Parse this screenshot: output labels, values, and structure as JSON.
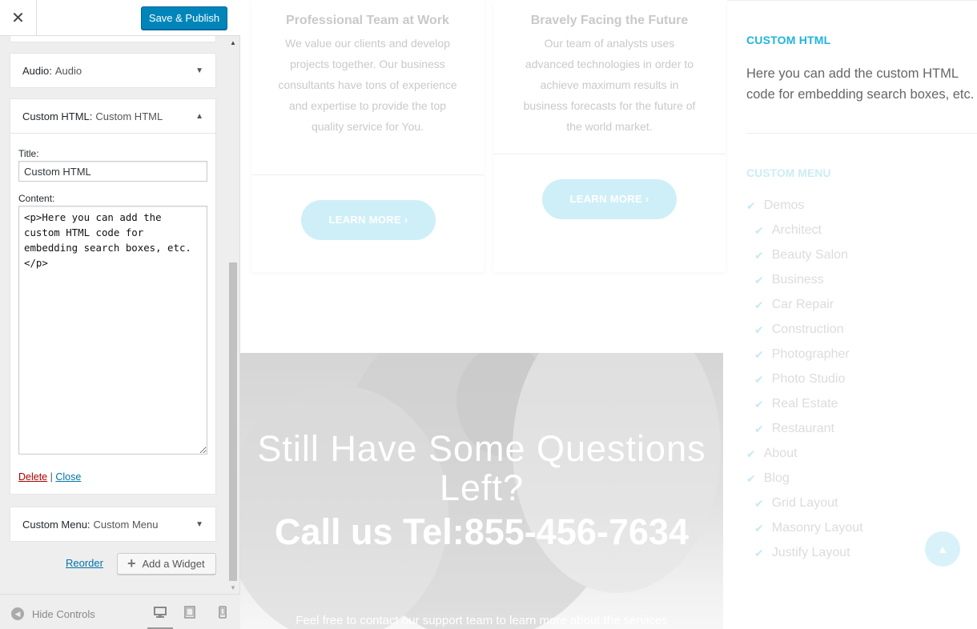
{
  "header": {
    "close_glyph": "✕",
    "save_label": "Save & Publish"
  },
  "widgets": {
    "audio": {
      "type": "Audio:",
      "name": "Audio"
    },
    "custom_html": {
      "type": "Custom HTML:",
      "name": "Custom HTML",
      "title_label": "Title:",
      "title_value": "Custom HTML",
      "content_label": "Content:",
      "content_value": "<p>Here you can add the custom HTML code for embedding search boxes, etc.</p>",
      "delete_label": "Delete",
      "separator": "|",
      "close_label": "Close"
    },
    "custom_menu": {
      "type": "Custom Menu:",
      "name": "Custom Menu"
    }
  },
  "actions": {
    "reorder_label": "Reorder",
    "add_widget_label": "Add a Widget"
  },
  "footer": {
    "hide_controls_label": "Hide Controls"
  },
  "preview": {
    "cards": [
      {
        "title": "Professional Team at Work",
        "text": "We value our clients and develop projects together. Our business consultants have tons of experience and expertise to provide the top quality service for You.",
        "button": "LEARN MORE ›"
      },
      {
        "title": "Bravely Facing the Future",
        "text": "Our team of analysts uses advanced technologies in order to achieve maximum results in business forecasts for the future of the world market.",
        "button": "LEARN MORE ›"
      }
    ],
    "cta": {
      "heading": "Still Have Some Questions Left?",
      "phone": "Call us Tel:855-456-7634",
      "subtext": "Feel free to contact our support team to learn more about the services"
    },
    "sidebar": {
      "html_title": "CUSTOM HTML",
      "html_text": "Here you can add the custom HTML code for embedding search boxes, etc.",
      "menu_title": "CUSTOM MENU",
      "menu_items": [
        {
          "label": "Demos",
          "level": 0
        },
        {
          "label": "Architect",
          "level": 1
        },
        {
          "label": "Beauty Salon",
          "level": 1
        },
        {
          "label": "Business",
          "level": 1
        },
        {
          "label": "Car Repair",
          "level": 1
        },
        {
          "label": "Construction",
          "level": 1
        },
        {
          "label": "Photographer",
          "level": 1
        },
        {
          "label": "Photo Studio",
          "level": 1
        },
        {
          "label": "Real Estate",
          "level": 1
        },
        {
          "label": "Restaurant",
          "level": 1
        },
        {
          "label": "About",
          "level": 0
        },
        {
          "label": "Blog",
          "level": 0
        },
        {
          "label": "Grid Layout",
          "level": 1
        },
        {
          "label": "Masonry Layout",
          "level": 1
        },
        {
          "label": "Justify Layout",
          "level": 1
        }
      ]
    }
  },
  "colors": {
    "primary_button": "#0085ba",
    "accent": "#1fb4dd",
    "delete_link": "#a00",
    "link": "#0073aa"
  },
  "icons": {
    "close": "close-icon",
    "collapse_down": "arrow-down-icon",
    "collapse_up": "arrow-up-icon",
    "plus": "plus-icon",
    "hide_controls": "collapse-left-icon",
    "desktop": "desktop-icon",
    "tablet": "tablet-icon",
    "mobile": "mobile-icon",
    "check": "check-icon",
    "back_to_top": "chevron-up-icon"
  }
}
